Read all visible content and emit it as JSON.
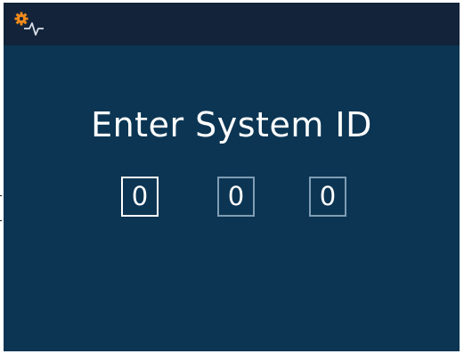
{
  "screen": {
    "title": "Enter System ID",
    "status_icon": "gear-pulse-icon",
    "colors": {
      "background": "#0b3553",
      "topbar": "#12233a",
      "text": "#ffffff",
      "icon_accent": "#f08a1c",
      "active_border": "#ffffff",
      "inactive_border": "#7f9db4"
    }
  },
  "system_id": {
    "digits": [
      {
        "value": "0",
        "active": true
      },
      {
        "value": "0",
        "active": false
      },
      {
        "value": "0",
        "active": false
      }
    ]
  }
}
